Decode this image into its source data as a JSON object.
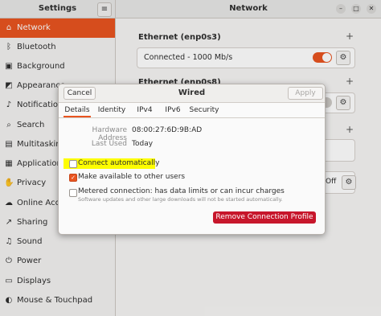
{
  "app": {
    "sidebar_title": "Settings",
    "panel_title": "Network",
    "menu_icon": "hamburger-icon"
  },
  "sidebar": {
    "items": [
      {
        "label": "Network",
        "icon": "network-icon",
        "glyph": "⌂",
        "active": true
      },
      {
        "label": "Bluetooth",
        "icon": "bluetooth-icon",
        "glyph": "ᛒ"
      },
      {
        "label": "Background",
        "icon": "background-icon",
        "glyph": "▣"
      },
      {
        "label": "Appearance",
        "icon": "appearance-icon",
        "glyph": "◩"
      },
      {
        "label": "Notifications",
        "icon": "notifications-icon",
        "glyph": "♪"
      },
      {
        "label": "Search",
        "icon": "search-icon",
        "glyph": "⌕"
      },
      {
        "label": "Multitasking",
        "icon": "multitasking-icon",
        "glyph": "▤"
      },
      {
        "label": "Applications",
        "icon": "applications-icon",
        "glyph": "▦"
      },
      {
        "label": "Privacy",
        "icon": "privacy-icon",
        "glyph": "✋"
      },
      {
        "label": "Online Accounts",
        "icon": "online-accounts-icon",
        "glyph": "☁"
      },
      {
        "label": "Sharing",
        "icon": "sharing-icon",
        "glyph": "↗"
      },
      {
        "label": "Sound",
        "icon": "sound-icon",
        "glyph": "♫"
      },
      {
        "label": "Power",
        "icon": "power-icon",
        "glyph": "⏻"
      },
      {
        "label": "Displays",
        "icon": "displays-icon",
        "glyph": "▭"
      },
      {
        "label": "Mouse & Touchpad",
        "icon": "mouse-icon",
        "glyph": "◐"
      }
    ]
  },
  "network": {
    "ethernet1": {
      "title": "Ethernet (enp0s3)",
      "status": "Connected - 1000 Mb/s",
      "toggle_on": true
    },
    "ethernet2": {
      "title": "Ethernet (enp0s8)",
      "toggle_on": false
    },
    "bottom_toggle_label": "Off"
  },
  "dialog": {
    "title": "Wired",
    "cancel_label": "Cancel",
    "apply_label": "Apply",
    "tabs": [
      "Details",
      "Identity",
      "IPv4",
      "IPv6",
      "Security"
    ],
    "active_tab": "Details",
    "hardware_address_label": "Hardware Address",
    "hardware_address": "08:00:27:6D:9B:AD",
    "last_used_label": "Last Used",
    "last_used": "Today",
    "connect_auto_label": "Connect automatically",
    "connect_auto_checked": false,
    "available_users_label": "Make available to other users",
    "available_users_checked": true,
    "metered_label": "Metered connection: has data limits or can incur charges",
    "metered_sub": "Software updates and other large downloads will not be started automatically.",
    "metered_checked": false,
    "remove_label": "Remove Connection Profile"
  },
  "colors": {
    "accent": "#e95420",
    "danger": "#c7162b",
    "highlight": "#fdfd00"
  }
}
